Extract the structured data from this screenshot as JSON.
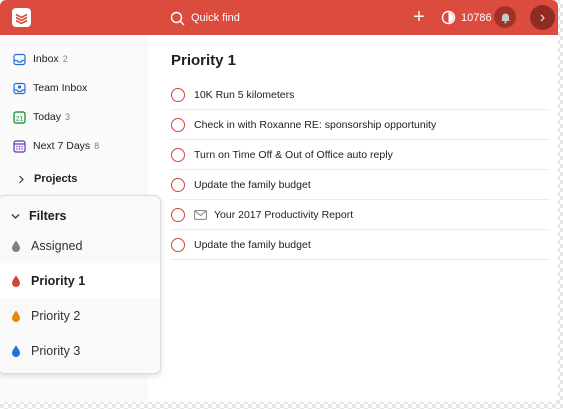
{
  "header": {
    "search_placeholder": "Quick find",
    "karma_score": "10786",
    "colors": {
      "brand": "#db4c3f"
    },
    "icons": [
      "todoist-logo-icon",
      "search-icon",
      "add-icon",
      "karma-icon",
      "notifications-icon",
      "forward-icon"
    ]
  },
  "sidebar": {
    "items": [
      {
        "label": "Inbox",
        "count": "2",
        "icon": "inbox-icon"
      },
      {
        "label": "Team Inbox",
        "count": "",
        "icon": "team-inbox-icon"
      },
      {
        "label": "Today",
        "count": "3",
        "icon": "calendar-today-icon"
      },
      {
        "label": "Next 7 Days",
        "count": "8",
        "icon": "calendar-week-icon"
      }
    ],
    "projects_label": "Projects",
    "filters": {
      "label": "Filters",
      "items": [
        {
          "label": "Assigned",
          "color": "#808080"
        },
        {
          "label": "Priority 1",
          "color": "#d1453b"
        },
        {
          "label": "Priority 2",
          "color": "#eb8909"
        },
        {
          "label": "Priority 3",
          "color": "#246fe0"
        }
      ]
    }
  },
  "main": {
    "title": "Priority 1",
    "tasks": [
      {
        "text": "10K Run 5 kilometers"
      },
      {
        "text": "Check in with Roxanne RE: sponsorship opportunity"
      },
      {
        "text": "Turn on Time Off & Out of Office auto reply"
      },
      {
        "text": "Update the family budget"
      },
      {
        "text": "Your 2017 Productivity Report",
        "icon": "mail-icon"
      },
      {
        "text": "Update the family budget"
      }
    ]
  }
}
